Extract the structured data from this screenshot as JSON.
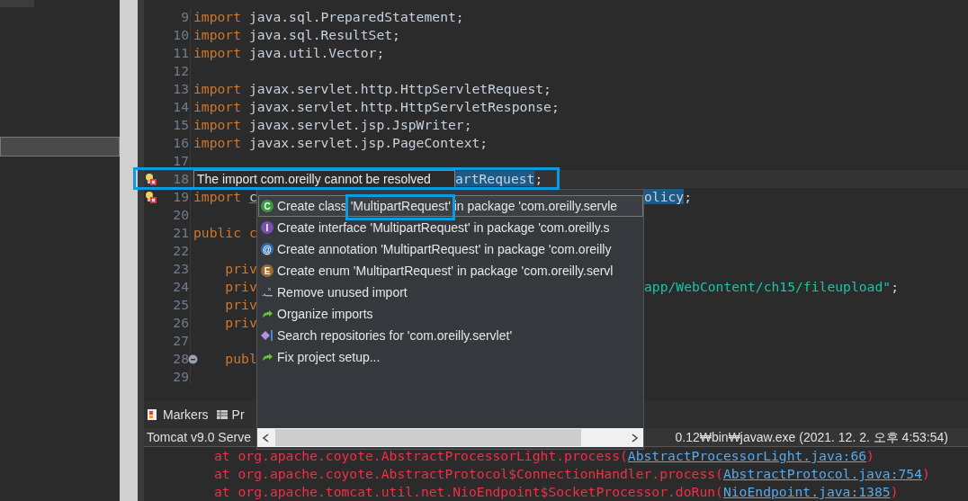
{
  "editor": {
    "lines": [
      {
        "number": "9",
        "segments": [
          {
            "kind": "keyword",
            "text": "import"
          },
          {
            "kind": "plain",
            "text": " java.sql.PreparedStatement;"
          }
        ]
      },
      {
        "number": "10",
        "segments": [
          {
            "kind": "keyword",
            "text": "import"
          },
          {
            "kind": "plain",
            "text": " java.sql.ResultSet;"
          }
        ]
      },
      {
        "number": "11",
        "segments": [
          {
            "kind": "keyword",
            "text": "import"
          },
          {
            "kind": "plain",
            "text": " java.util.Vector;"
          }
        ]
      },
      {
        "number": "12"
      },
      {
        "number": "13",
        "segments": [
          {
            "kind": "keyword",
            "text": "import"
          },
          {
            "kind": "plain",
            "text": " javax.servlet.http.HttpServletRequest;"
          }
        ]
      },
      {
        "number": "14",
        "segments": [
          {
            "kind": "keyword",
            "text": "import"
          },
          {
            "kind": "plain",
            "text": " javax.servlet.http.HttpServletResponse;"
          }
        ]
      },
      {
        "number": "15",
        "segments": [
          {
            "kind": "keyword",
            "text": "import"
          },
          {
            "kind": "plain",
            "text": " javax.servlet.jsp.JspWriter;"
          }
        ]
      },
      {
        "number": "16",
        "segments": [
          {
            "kind": "keyword",
            "text": "import"
          },
          {
            "kind": "plain",
            "text": " javax.servlet.jsp.PageContext;"
          }
        ]
      },
      {
        "number": "17"
      },
      {
        "number": "18",
        "kind": "error",
        "current": true,
        "tooltip": "The import com.oreilly cannot be resolved",
        "tail": [
          {
            "kind": "selection",
            "text": "artRequest"
          },
          {
            "kind": "plain",
            "text": ";"
          }
        ]
      },
      {
        "number": "19",
        "kind": "error",
        "segments": [
          {
            "kind": "keyword",
            "text": "import "
          },
          {
            "kind": "error",
            "text": "c"
          }
        ],
        "tail": [
          {
            "kind": "selection",
            "text": "olicy"
          },
          {
            "kind": "plain",
            "text": ";"
          }
        ]
      },
      {
        "number": "20"
      },
      {
        "number": "21",
        "segments": [
          {
            "kind": "keyword",
            "text": "public c"
          }
        ]
      },
      {
        "number": "22"
      },
      {
        "number": "23",
        "segments": [
          {
            "kind": "keyword",
            "text": "    priv"
          }
        ]
      },
      {
        "number": "24",
        "segments": [
          {
            "kind": "keyword",
            "text": "    priv"
          }
        ],
        "tail": [
          {
            "kind": "string",
            "text": "app/WebContent/ch15/fileupload\""
          },
          {
            "kind": "plain",
            "text": ";"
          }
        ]
      },
      {
        "number": "25",
        "segments": [
          {
            "kind": "keyword",
            "text": "    priv"
          }
        ]
      },
      {
        "number": "26",
        "segments": [
          {
            "kind": "keyword",
            "text": "    priv"
          }
        ]
      },
      {
        "number": "27"
      },
      {
        "number": "28",
        "kind": "fold",
        "segments": [
          {
            "kind": "keyword",
            "text": "    publ"
          }
        ]
      },
      {
        "number": "29"
      }
    ]
  },
  "quick_fix": {
    "items": [
      {
        "kind": "class",
        "badge": "C",
        "text": "Create class 'MultipartRequest' in package 'com.oreilly.servle",
        "selected": true
      },
      {
        "kind": "interface",
        "badge": "I",
        "text": "Create interface 'MultipartRequest' in package 'com.oreilly.s",
        "selected": false
      },
      {
        "kind": "annotation",
        "badge": "@",
        "text": "Create annotation 'MultipartRequest' in package 'com.oreilly",
        "selected": false
      },
      {
        "kind": "enum",
        "badge": "E",
        "text": "Create enum 'MultipartRequest' in package 'com.oreilly.servl",
        "selected": false
      },
      {
        "kind": "remove",
        "text": "Remove unused import",
        "selected": false
      },
      {
        "kind": "arrow",
        "text": "Organize imports",
        "selected": false
      },
      {
        "kind": "diamond",
        "text": "Search repositories for 'com.oreilly.servlet'",
        "selected": false
      },
      {
        "kind": "arrow",
        "text": "Fix project setup...",
        "selected": false
      }
    ]
  },
  "bottom_panel": {
    "tabs": [
      {
        "kind": "markers",
        "label": "Markers"
      },
      {
        "kind": "table",
        "label": "Pr"
      }
    ],
    "console_title_left": "Tomcat v9.0 Serve",
    "console_title_right": "0.12₩bin₩javaw.exe (2021. 12. 2. 오후 4:53:54)",
    "console_lines": [
      {
        "text": "at org.apache.coyote.AbstractProcessorLight.process(",
        "link": "AbstractProcessorLight.java:66",
        "end": ")"
      },
      {
        "text": "at org.apache.coyote.AbstractProtocol$ConnectionHandler.process(",
        "link": "AbstractProtocol.java:754",
        "end": ")"
      },
      {
        "text": "at org.apache.tomcat.util.net.NioEndpoint$SocketProcessor.doRun(",
        "link": "NioEndpoint.java:1385",
        "end": ")"
      }
    ]
  }
}
